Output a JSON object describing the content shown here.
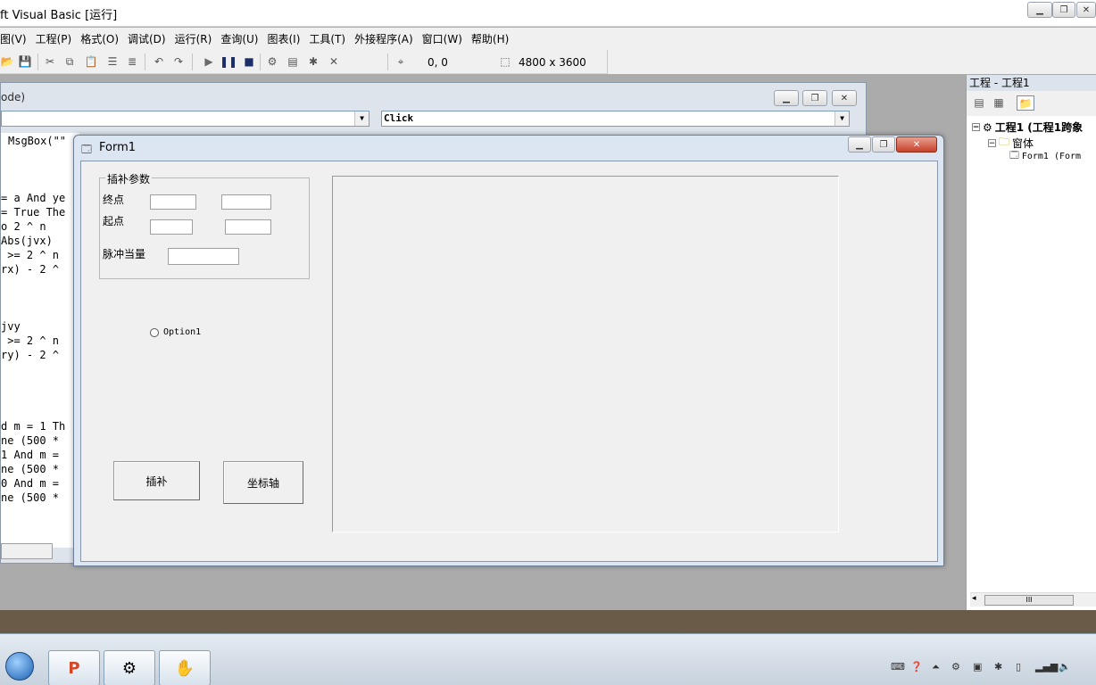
{
  "app": {
    "title": "ft Visual Basic [运行]"
  },
  "menubar": {
    "items": [
      "图(V)",
      "工程(P)",
      "格式(O)",
      "调试(D)",
      "运行(R)",
      "查询(U)",
      "图表(I)",
      "工具(T)",
      "外接程序(A)",
      "窗口(W)",
      "帮助(H)"
    ]
  },
  "toolbar": {
    "position_readout": "0, 0",
    "size_readout": "4800 x 3600"
  },
  "code_window": {
    "title": "ode)",
    "object_combo": "",
    "procedure_combo": "Click",
    "lines": [
      "MsgBox(\"\"",
      "= a And ye",
      "= True The",
      "o 2 ^ n",
      "Abs(jvx)",
      " >= 2 ^ n",
      "rx) - 2 ^",
      "jvy",
      " >= 2 ^ n",
      "ry) - 2 ^",
      "d m = 1 Th",
      "ne (500 *",
      "1 And m =",
      "ne (500 *",
      "0 And m =",
      "ne (500 *"
    ]
  },
  "form1": {
    "title": "Form1",
    "group_title": "插补参数",
    "label_end": "终点",
    "label_start": "起点",
    "label_pulse": "脉冲当量",
    "option_label": "Option1",
    "button_interp": "插补",
    "button_axis": "坐标轴",
    "fields": {
      "end_x": "",
      "end_y": "",
      "start_x": "",
      "start_y": "",
      "pulse": ""
    }
  },
  "project": {
    "title": "工程 - 工程1",
    "root": "工程1 (工程1跨象",
    "folder": "窗体",
    "form_item": "Form1 (Form"
  },
  "scrollbar": {
    "thumb_glyph": "III"
  }
}
